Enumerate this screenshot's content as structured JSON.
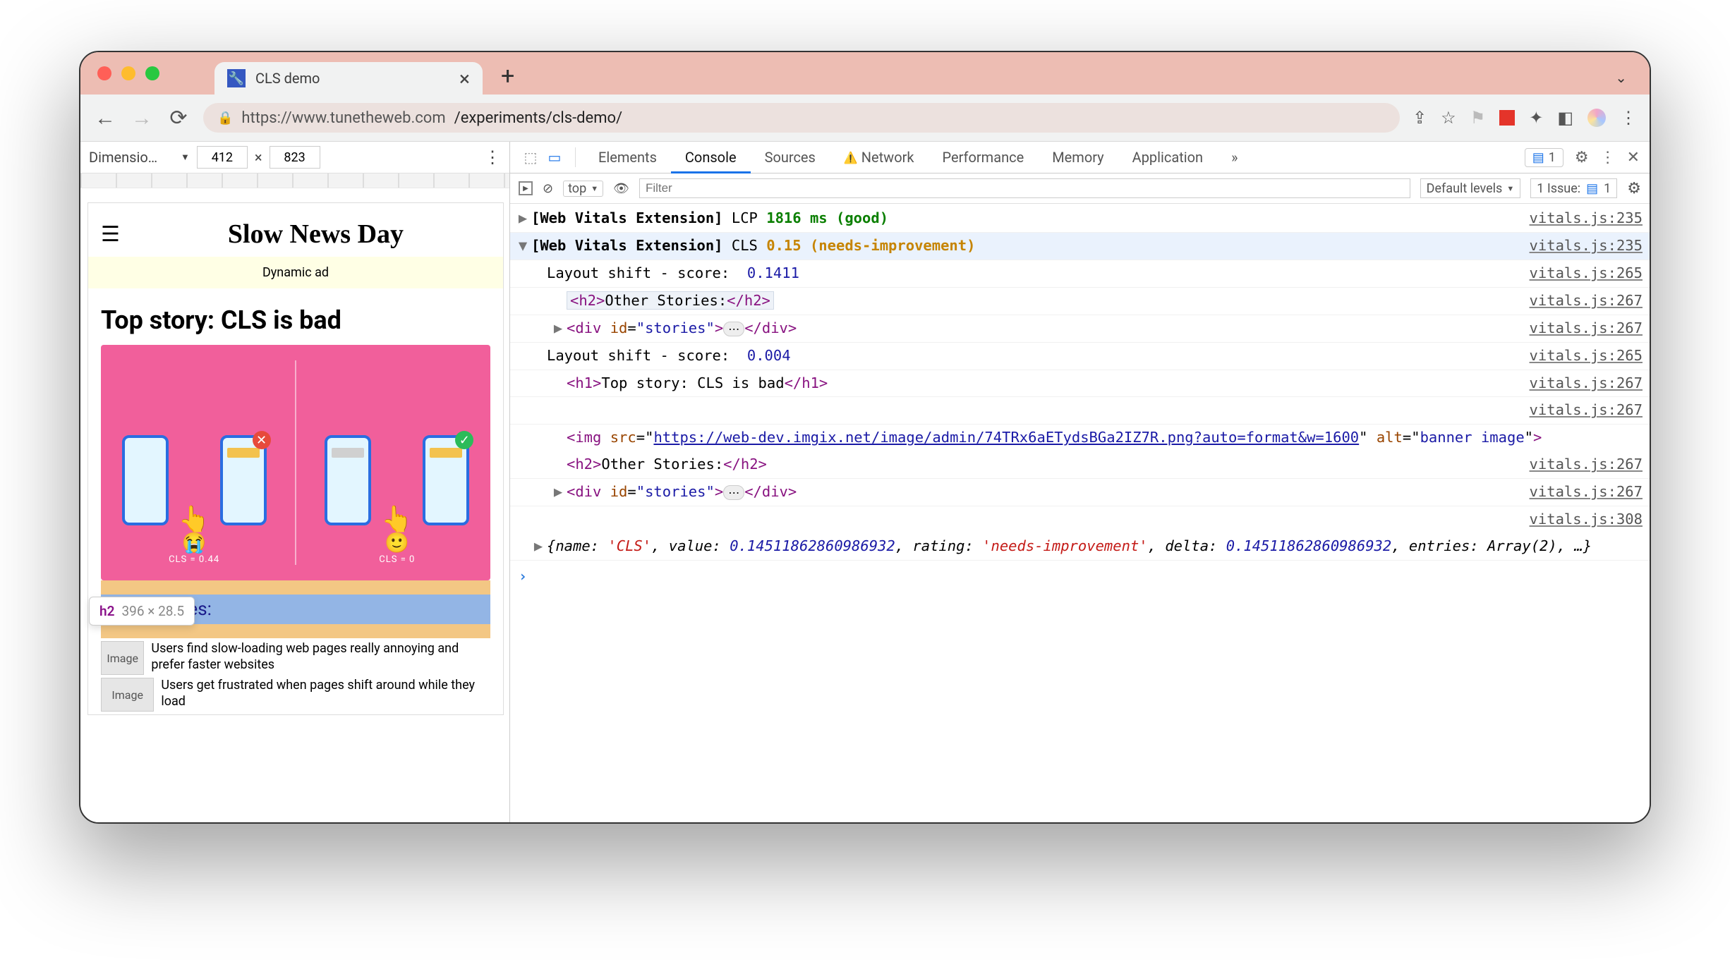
{
  "browser": {
    "tab_title": "CLS demo",
    "url_host": "https://www.tunetheweb.com",
    "url_path": "/experiments/cls-demo/"
  },
  "device": {
    "dimensions_label": "Dimensio…",
    "width": "412",
    "height": "823",
    "sep": "×"
  },
  "page": {
    "site_title": "Slow News Day",
    "ad_text": "Dynamic ad",
    "top_story": "Top story: CLS is bad",
    "banner": {
      "left_face": "😭",
      "left_val": "CLS = 0.44",
      "right_face": "🙂",
      "right_val": "CLS = 0"
    },
    "other_stories_heading": "Other Stories:",
    "stories": [
      {
        "img": "Image",
        "txt": "Users find slow-loading web pages really annoying and prefer faster websites"
      },
      {
        "img": "Image",
        "txt": "Users get frustrated when pages shift around while they load"
      }
    ],
    "tooltip": {
      "tag": "h2",
      "dims": "396 × 28.5"
    }
  },
  "devtools_tabs": {
    "elements": "Elements",
    "console": "Console",
    "sources": "Sources",
    "network": "Network",
    "performance": "Performance",
    "memory": "Memory",
    "application": "Application",
    "badge_count": "1"
  },
  "console_toolbar": {
    "context": "top",
    "filter_placeholder": "Filter",
    "levels": "Default levels",
    "issues_label": "1 Issue:",
    "issues_count": "1"
  },
  "console": {
    "prefix": "[Web Vitals Extension]",
    "lcp_label": "LCP",
    "lcp_value": "1816 ms (good)",
    "cls_label": "CLS",
    "cls_value": "0.15 (needs-improvement)",
    "rows": [
      {
        "text": "Layout shift - score:",
        "val": "0.1411",
        "src": "vitals.js:265"
      },
      {
        "el": "<h2>Other Stories:</h2>",
        "boxed": true,
        "src": "vitals.js:267"
      },
      {
        "el": "<div id=\"stories\">…</div>",
        "expand": true,
        "src": "vitals.js:267"
      },
      {
        "text": "Layout shift - score:",
        "val": "0.004",
        "src": "vitals.js:265"
      },
      {
        "el": "<h1>Top story: CLS is bad</h1>",
        "src": "vitals.js:267"
      },
      {
        "src_only": "vitals.js:267"
      },
      {
        "img_src": "https://web-dev.imgix.net/image/admin/74TRx6aETydsBGa2IZ7R.png?auto=format&w=1600",
        "img_alt": "banner image"
      },
      {
        "el": "<h2>Other Stories:</h2>",
        "src": "vitals.js:267"
      },
      {
        "el": "<div id=\"stories\">…</div>",
        "expand": true,
        "src": "vitals.js:267"
      },
      {
        "src_only": "vitals.js:308"
      }
    ],
    "obj": "{name: 'CLS', value: 0.14511862860986932, rating: 'needs-improvement', delta: 0.14511862860986932, entries: Array(2), …}",
    "lcp_src": "vitals.js:235",
    "cls_src": "vitals.js:235"
  }
}
